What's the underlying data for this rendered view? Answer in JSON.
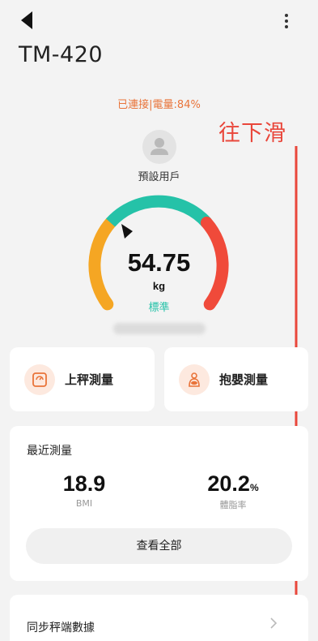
{
  "header": {
    "device_name": "TM-420",
    "back_icon": "back-arrow-icon",
    "more_icon": "more-vertical-icon"
  },
  "status": {
    "connection_text": "已連接|電量:84%",
    "accent_color": "#e9743a"
  },
  "annotation": {
    "text": "往下滑",
    "color": "#e9473b"
  },
  "user": {
    "name": "預設用戶",
    "avatar_icon": "user-avatar-icon"
  },
  "gauge": {
    "weight": "54.75",
    "unit": "kg",
    "status": "標準",
    "colors": {
      "low": "#f5a623",
      "normal": "#25c2a8",
      "high": "#f04a3a"
    }
  },
  "modes": {
    "scale": {
      "label": "上秤測量",
      "icon": "scale-icon"
    },
    "baby": {
      "label": "抱嬰測量",
      "icon": "baby-hold-icon"
    }
  },
  "recent": {
    "title": "最近測量",
    "bmi": {
      "value": "18.9",
      "label": "BMI"
    },
    "body_fat": {
      "value": "20.2",
      "unit": "%",
      "label": "體脂率"
    },
    "view_all_label": "查看全部"
  },
  "sync": {
    "title": "同步秤端數據",
    "chevron_icon": "chevron-right-icon"
  }
}
